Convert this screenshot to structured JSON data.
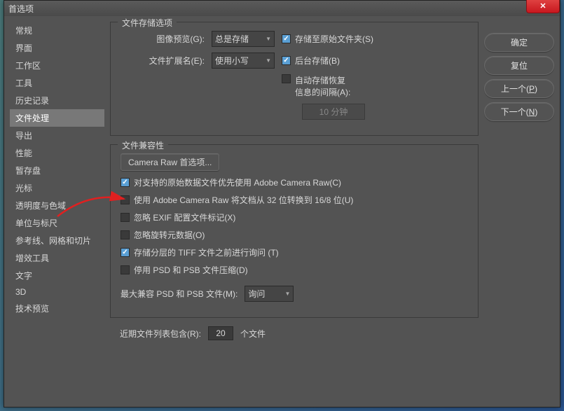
{
  "title": "首选项",
  "sidebar": {
    "items": [
      {
        "label": "常规"
      },
      {
        "label": "界面"
      },
      {
        "label": "工作区"
      },
      {
        "label": "工具"
      },
      {
        "label": "历史记录"
      },
      {
        "label": "文件处理",
        "selected": true
      },
      {
        "label": "导出"
      },
      {
        "label": "性能"
      },
      {
        "label": "暂存盘"
      },
      {
        "label": "光标"
      },
      {
        "label": "透明度与色域"
      },
      {
        "label": "单位与标尺"
      },
      {
        "label": "参考线、网格和切片"
      },
      {
        "label": "增效工具"
      },
      {
        "label": "文字"
      },
      {
        "label": "3D"
      },
      {
        "label": "技术预览"
      }
    ]
  },
  "buttons": {
    "ok": "确定",
    "cancel": "复位",
    "prev": "上一个(P)",
    "next": "下一个(N)"
  },
  "storage": {
    "legend": "文件存储选项",
    "preview_label": "图像预览(G):",
    "preview_value": "总是存储",
    "ext_label": "文件扩展名(E):",
    "ext_value": "使用小写",
    "save_original": "存储至原始文件夹(S)",
    "save_background": "后台存储(B)",
    "autosave_line1": "自动存储恢复",
    "autosave_line2": "信息的间隔(A):",
    "autosave_value": "10 分钟"
  },
  "compat": {
    "legend": "文件兼容性",
    "camera_raw_btn": "Camera Raw 首选项...",
    "opt1": "对支持的原始数据文件优先使用 Adobe Camera Raw(C)",
    "opt2": "使用 Adobe Camera Raw 将文档从 32 位转换到 16/8 位(U)",
    "opt3": "忽略 EXIF 配置文件标记(X)",
    "opt4": "忽略旋转元数据(O)",
    "opt5": "存储分层的 TIFF 文件之前进行询问 (T)",
    "opt6": "停用 PSD 和 PSB 文件压缩(D)",
    "max_label": "最大兼容 PSD 和 PSB 文件(M):",
    "max_value": "询问"
  },
  "recent": {
    "label": "近期文件列表包含(R):",
    "value": "20",
    "suffix": "个文件"
  }
}
